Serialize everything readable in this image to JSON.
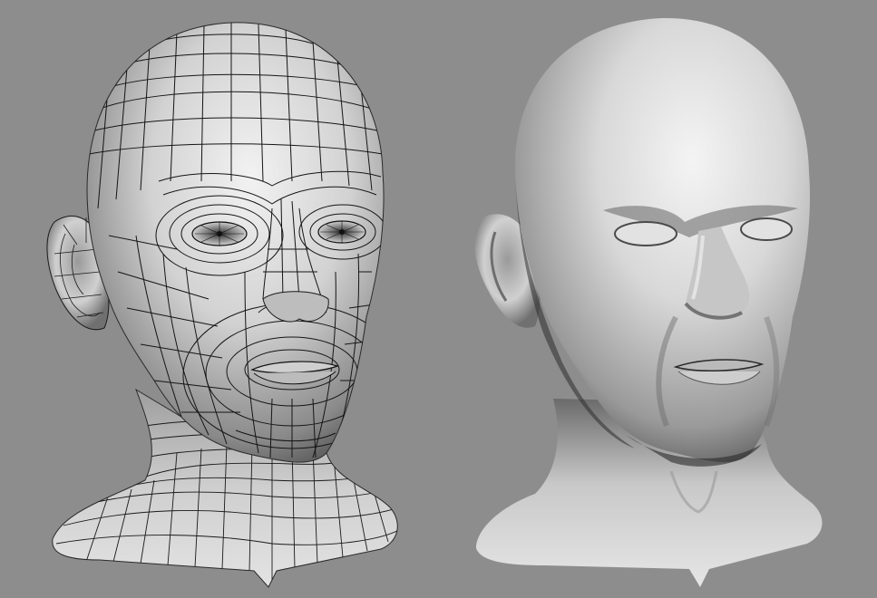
{
  "scene": {
    "background": "#8d8d8d",
    "views": [
      {
        "id": "wireframe-head",
        "shading": "smooth-with-wireframe",
        "wire_color": "#1a1a1a"
      },
      {
        "id": "smooth-head",
        "shading": "smooth"
      }
    ]
  }
}
